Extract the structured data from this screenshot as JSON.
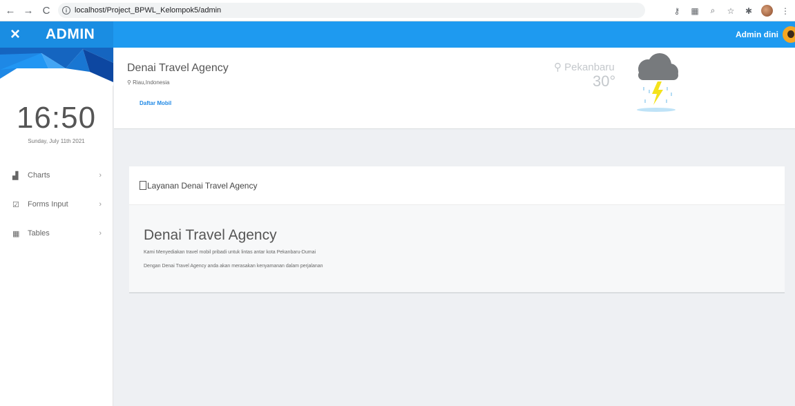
{
  "browser": {
    "back": "←",
    "forward": "→",
    "reload": "C",
    "url": "localhost/Project_BPWL_Kelompok5/admin"
  },
  "header": {
    "close_glyph": "×",
    "title": "ADMIN",
    "user": "Admin dini"
  },
  "sidebar": {
    "time": "16:50",
    "date": "Sunday, July 11th 2021",
    "items": [
      {
        "label": "Charts",
        "icon": "chart-icon"
      },
      {
        "label": "Forms Input",
        "icon": "checkbox-icon"
      },
      {
        "label": "Tables",
        "icon": "table-icon"
      }
    ]
  },
  "info": {
    "company": "Denai Travel Agency",
    "location": "Riau,Indonesia",
    "link": "Daftar Mobil",
    "weather_city": "Pekanbaru",
    "weather_temp": "30°"
  },
  "card": {
    "header": "Layanan Denai Travel Agency",
    "title": "Denai Travel Agency",
    "line1": "Kami Menyediakan travel mobil pribadi untuk lintas antar kota Pekanbaru-Dumai",
    "line2": "Dengan Denai Travel Agency anda akan merasakan kenyamanan dalam perjalanan"
  },
  "colors": {
    "topbar": "#1e9af0",
    "brand": "#1a8de2",
    "link": "#1e88e5",
    "background": "#eef0f3"
  }
}
